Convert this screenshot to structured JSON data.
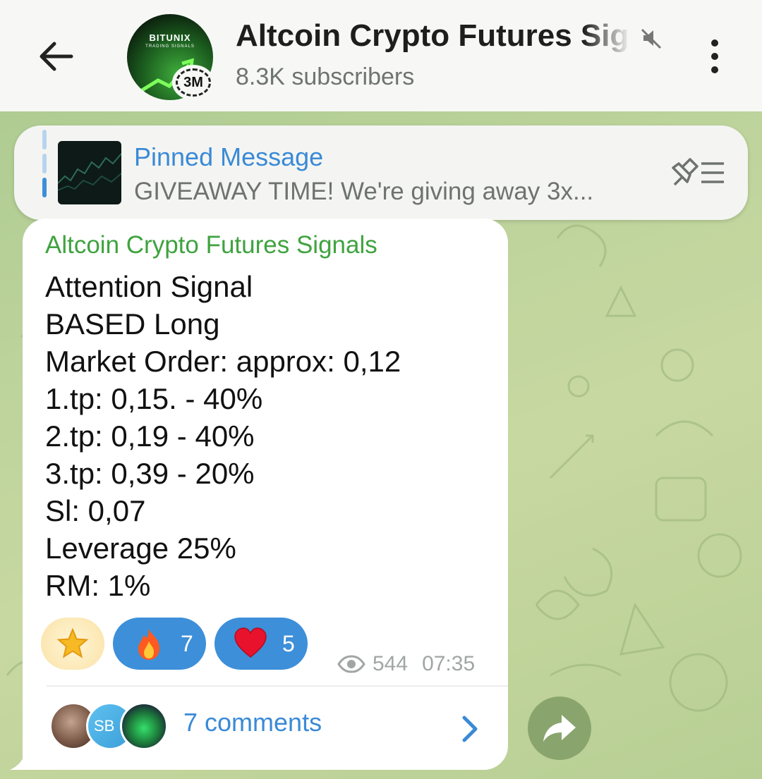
{
  "header": {
    "back_icon": "arrow-left-icon",
    "avatar": {
      "brand": "BITUNIX",
      "brand_sub": "TRADING SIGNALS",
      "story_badge": "3M"
    },
    "title": "Altcoin Crypto Futures Signals",
    "muted_icon": "speaker-muted-icon",
    "subtitle": "8.3K subscribers",
    "menu_icon": "more-vertical-icon"
  },
  "pinned": {
    "title": "Pinned Message",
    "text": "GIVEAWAY TIME!   We're giving away 3x...",
    "list_icon": "pin-list-icon"
  },
  "message": {
    "sender": "Altcoin Crypto Futures Signals",
    "lines": [
      "Attention Signal",
      "BASED Long",
      "Market Order: approx: 0,12",
      "1.tp: 0,15. - 40%",
      "2.tp: 0,19 - 40%",
      "3.tp: 0,39 - 20%",
      "Sl: 0,07",
      "Leverage 25%",
      "RM: 1%"
    ],
    "reactions": [
      {
        "emoji": "star",
        "icon": "star-icon"
      },
      {
        "emoji": "fire",
        "icon": "fire-icon",
        "count": "7"
      },
      {
        "emoji": "heart",
        "icon": "heart-icon",
        "count": "5"
      }
    ],
    "views": "544",
    "time": "07:35",
    "comments_label": "7 comments",
    "commenter_initials": "SB"
  },
  "colors": {
    "accent_blue": "#3d8fd9",
    "sender_green": "#3fa33f",
    "header_bg": "#f7f8f5"
  }
}
